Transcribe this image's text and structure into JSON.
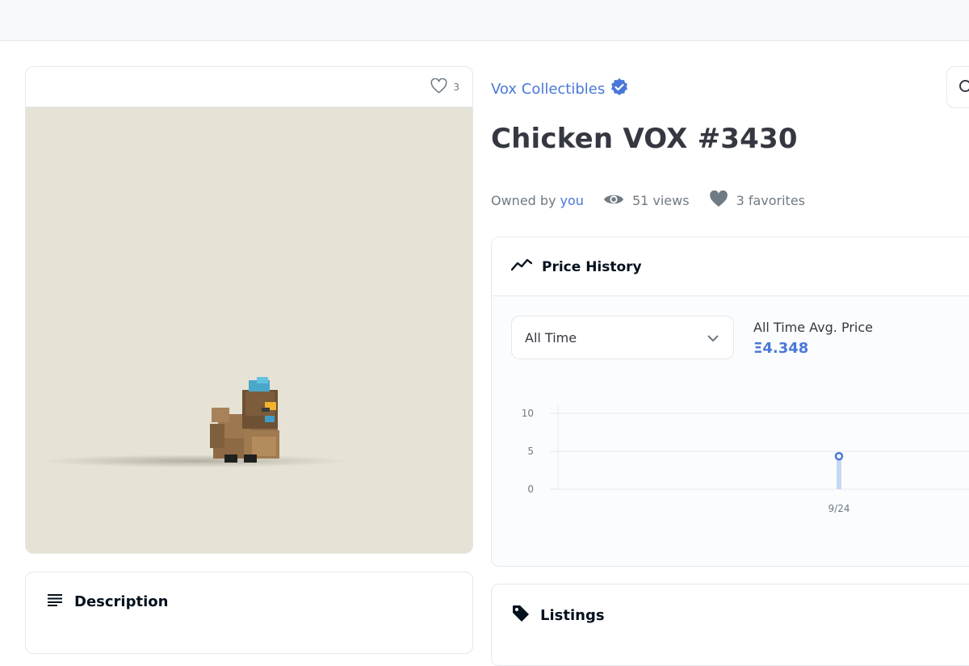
{
  "asset": {
    "favorite_count": "3",
    "collection_name": "Vox Collectibles",
    "title": "Chicken VOX #3430",
    "owned_by_label": "Owned by",
    "owner": "you",
    "views": "51 views",
    "favorites": "3 favorites"
  },
  "description": {
    "title": "Description"
  },
  "price_history": {
    "title": "Price History",
    "period_selected": "All Time",
    "avg_label": "All Time Avg. Price",
    "avg_value": "Ξ4.348"
  },
  "listings": {
    "title": "Listings"
  },
  "icons": {
    "verified": "verified-badge-icon",
    "eye": "eye-icon",
    "heart": "heart-icon",
    "chart": "trending-line-icon",
    "description": "lines-icon",
    "tag": "tag-icon",
    "chevron": "chevron-down-icon",
    "search": "search-icon"
  },
  "colors": {
    "accent": "#4a78d8",
    "image_background": "#e6e2d5",
    "chart_bar": "#c5d9f5"
  },
  "chart_data": {
    "type": "bar",
    "categories": [
      "9/24"
    ],
    "values": [
      4.348
    ],
    "ylim": [
      0,
      10
    ],
    "yticks": [
      0,
      5,
      10
    ],
    "grid": true,
    "title": "",
    "xlabel": "",
    "ylabel": ""
  }
}
